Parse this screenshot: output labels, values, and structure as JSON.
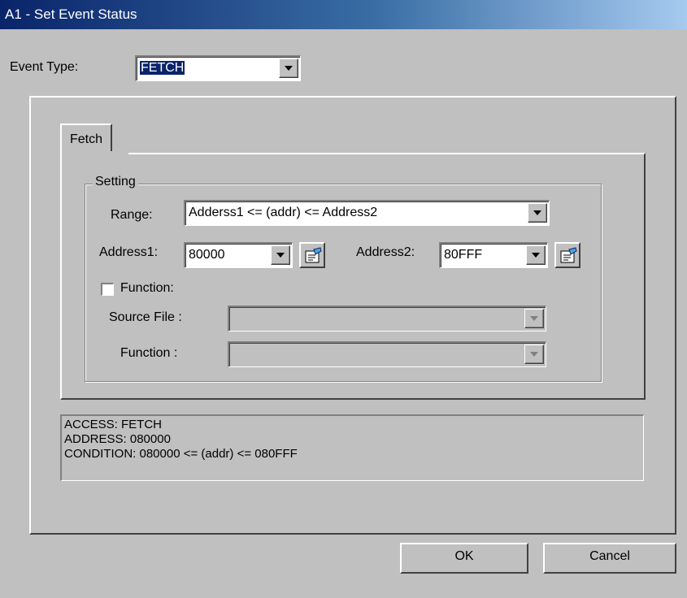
{
  "window": {
    "title": "A1 - Set Event Status"
  },
  "event_type": {
    "label": "Event Type:",
    "value": "FETCH"
  },
  "tabs": [
    {
      "label": "Fetch"
    }
  ],
  "setting": {
    "group_label": "Setting",
    "range": {
      "label": "Range:",
      "value": "Adderss1 <= (addr) <= Address2"
    },
    "address1": {
      "label": "Address1:",
      "value": "80000"
    },
    "address2": {
      "label": "Address2:",
      "value": "80FFF"
    },
    "function_checkbox": {
      "label": "Function:",
      "checked": false
    },
    "source_file": {
      "label": "Source File :",
      "value": ""
    },
    "function": {
      "label": "Function :",
      "value": ""
    }
  },
  "info": {
    "lines": [
      "ACCESS: FETCH",
      "ADDRESS: 080000",
      "CONDITION: 080000 <= (addr) <= 080FFF"
    ]
  },
  "buttons": {
    "ok": "OK",
    "cancel": "Cancel"
  },
  "icons": {
    "browse": "browse-icon",
    "dropdown": "chevron-down-icon"
  }
}
